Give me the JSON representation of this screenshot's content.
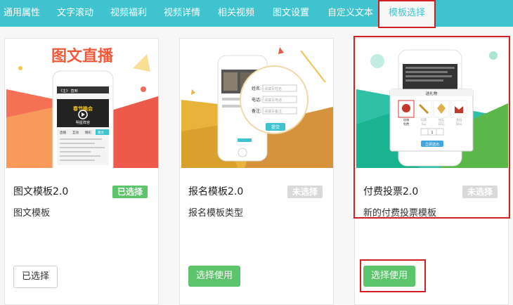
{
  "tabs": [
    {
      "label": "通用属性"
    },
    {
      "label": "文字滚动"
    },
    {
      "label": "视频福利"
    },
    {
      "label": "视频详情"
    },
    {
      "label": "相关视频"
    },
    {
      "label": "图文设置"
    },
    {
      "label": "自定义文本"
    },
    {
      "label": "模板选择"
    }
  ],
  "colors": {
    "accent": "#3fc4cf",
    "green": "#5cc46a",
    "highlight": "#d21f1f"
  },
  "cards": [
    {
      "title": "图文模板2.0",
      "badge": "已选择",
      "description": "图文模板",
      "button": "已选择",
      "preview": {
        "banner": "图文直播",
        "phone_header": "《主》 直到",
        "video_caption": "春节晚会",
        "video_sub": "明星阵容",
        "tabs": [
          "直播",
          "互动",
          "精彩",
          "图文"
        ],
        "icon": "play-icon"
      }
    },
    {
      "title": "报名模板2.0",
      "badge": "未选择",
      "description": "报名模板类型",
      "button": "选择使用",
      "preview": {
        "labels": [
          "姓名:",
          "电话:",
          "备注:"
        ],
        "placeholders": [
          "请填写姓名",
          "请填写电话",
          "请填写备注"
        ],
        "submit": "提交"
      }
    },
    {
      "title": "付费投票2.0",
      "badge": "未选择",
      "description": "新的付费投票模板",
      "button": "选择使用",
      "preview": {
        "dialog_title": "送礼物",
        "gift_names": [
          "玫瑰",
          "话筒",
          "钻石",
          "皇冠"
        ],
        "gift_prices": [
          "免费",
          "5元",
          "10元",
          "50元"
        ],
        "quantity": "1",
        "confirm": "立即送出"
      }
    }
  ]
}
